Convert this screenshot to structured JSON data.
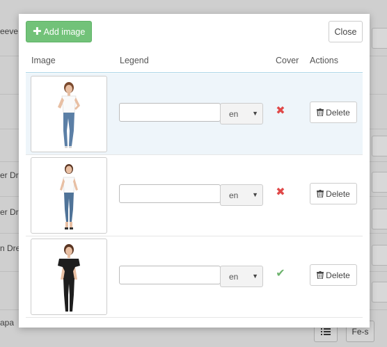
{
  "background": {
    "row_texts": [
      "eeve",
      "er Dr",
      "er Dr",
      "n Dres",
      "apa"
    ],
    "footer_buttons": [
      {
        "icon": "list-icon",
        "label": ""
      },
      {
        "icon": "",
        "label": "Fe-s"
      }
    ]
  },
  "modal": {
    "add_button": {
      "icon": "plus-icon",
      "label": "Add image"
    },
    "close_button": {
      "label": "Close"
    },
    "columns": {
      "image": "Image",
      "legend": "Legend",
      "cover": "Cover",
      "actions": "Actions"
    },
    "rows": [
      {
        "legend_value": "",
        "language": "en",
        "cover": false,
        "cover_icon": "cross-icon",
        "delete_label": "Delete",
        "image_desc": "woman in white t-shirt and jeans",
        "outfit_color": "#ffffff",
        "pants_color": "#5b7fa6"
      },
      {
        "legend_value": "",
        "language": "en",
        "cover": false,
        "cover_icon": "cross-icon",
        "delete_label": "Delete",
        "image_desc": "woman in white top and jeans",
        "outfit_color": "#ffffff",
        "pants_color": "#4f7398"
      },
      {
        "legend_value": "",
        "language": "en",
        "cover": true,
        "cover_icon": "check-icon",
        "delete_label": "Delete",
        "image_desc": "woman in black top and black pants",
        "outfit_color": "#1e1e1e",
        "pants_color": "#1e1e1e"
      }
    ]
  },
  "colors": {
    "add_button_bg": "#72c279",
    "cross": "#e04848",
    "check": "#6db36d",
    "header_border": "#a8d3e6",
    "highlight_row": "#eef5fa"
  }
}
